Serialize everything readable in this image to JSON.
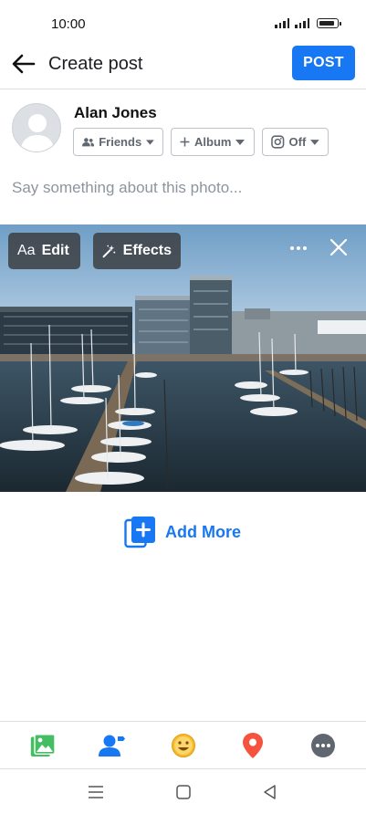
{
  "status": {
    "time": "10:00"
  },
  "header": {
    "title": "Create post",
    "post_label": "POST"
  },
  "composer": {
    "username": "Alan Jones",
    "audience_label": "Friends",
    "album_label": "Album",
    "instagram_label": "Off",
    "caption_placeholder": "Say something about this photo..."
  },
  "photo_overlay": {
    "edit_prefix": "Aa",
    "edit_label": "Edit",
    "effects_label": "Effects"
  },
  "add_more_label": "Add More",
  "toolbar": {
    "icons": [
      "photo-icon",
      "tag-people-icon",
      "feeling-icon",
      "location-icon",
      "more-icon"
    ],
    "colors": {
      "photo": "#45bd62",
      "tag": "#1877f2",
      "feeling": "#f7b928",
      "location": "#f5533d",
      "more": "#606770"
    }
  },
  "theme": {
    "accent": "#1877f2"
  }
}
